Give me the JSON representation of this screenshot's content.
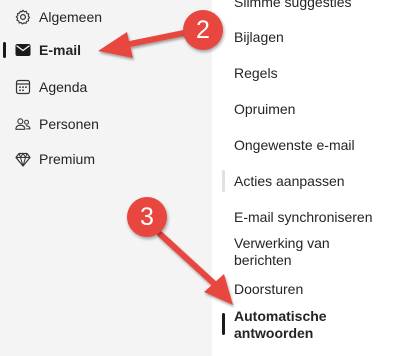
{
  "sidebar": {
    "items": [
      {
        "label": "Algemeen",
        "icon": "gear-icon"
      },
      {
        "label": "E-mail",
        "icon": "mail-icon",
        "active": true
      },
      {
        "label": "Agenda",
        "icon": "calendar-icon"
      },
      {
        "label": "Personen",
        "icon": "people-icon"
      },
      {
        "label": "Premium",
        "icon": "diamond-icon"
      }
    ]
  },
  "mail_settings": {
    "items": [
      {
        "label": "Slimme suggesties"
      },
      {
        "label": "Bijlagen"
      },
      {
        "label": "Regels"
      },
      {
        "label": "Opruimen"
      },
      {
        "label": "Ongewenste e-mail"
      },
      {
        "label": "Acties aanpassen"
      },
      {
        "label": "E-mail synchroniseren"
      },
      {
        "label": "Verwerking van",
        "label2": "berichten"
      },
      {
        "label": "Doorsturen"
      },
      {
        "label": "Automatische",
        "label2": "antwoorden",
        "active": true
      }
    ]
  },
  "annotations": {
    "badge_2": "2",
    "badge_3": "3"
  },
  "colors": {
    "sidebar_bg": "#f4f4f4",
    "annotation_red": "#e8473f",
    "active_indicator": "#1a1a1a"
  }
}
